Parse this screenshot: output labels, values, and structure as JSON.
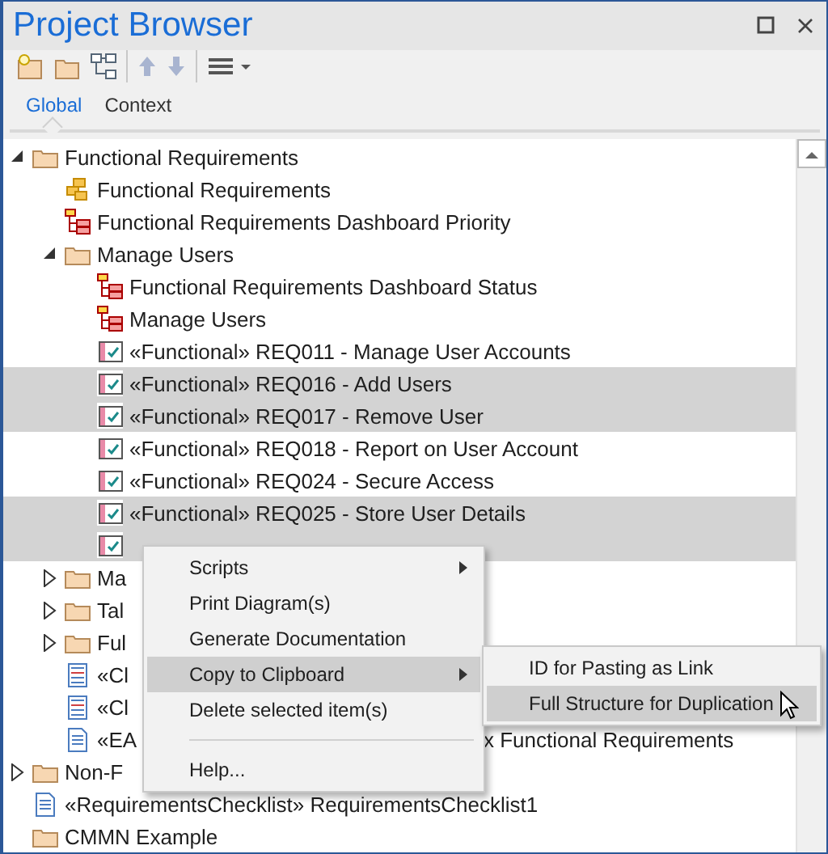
{
  "window": {
    "title": "Project Browser"
  },
  "tabs": [
    {
      "label": "Global",
      "selected": true
    },
    {
      "label": "Context",
      "selected": false
    }
  ],
  "tree": [
    {
      "children": [
        {
          "label": "Functional Requirements",
          "kind": "folder",
          "expanded": true,
          "selected": false,
          "children": [
            {
              "label": "Functional Requirements",
              "kind": "package",
              "selected": false
            },
            {
              "label": "Functional Requirements Dashboard Priority",
              "kind": "diagram",
              "selected": false
            },
            {
              "label": "Manage Users",
              "kind": "folder",
              "expanded": true,
              "selected": false,
              "children": [
                {
                  "label": "Functional Requirements Dashboard Status",
                  "kind": "diagram",
                  "selected": false
                },
                {
                  "label": "Manage Users",
                  "kind": "diagram",
                  "selected": false
                },
                {
                  "label": "«Functional» REQ011 - Manage User Accounts",
                  "kind": "requirement",
                  "selected": false
                },
                {
                  "label": "«Functional» REQ016 - Add Users",
                  "kind": "requirement",
                  "selected": true
                },
                {
                  "label": "«Functional» REQ017 - Remove User",
                  "kind": "requirement",
                  "selected": true
                },
                {
                  "label": "«Functional» REQ018 - Report on User Account",
                  "kind": "requirement",
                  "selected": false
                },
                {
                  "label": "«Functional» REQ024 - Secure Access",
                  "kind": "requirement",
                  "selected": false
                },
                {
                  "label": "«Functional» REQ025 - Store User Details",
                  "kind": "requirement",
                  "selected": true
                },
                {
                  "kind": "requirement",
                  "selected": true
                }
              ]
            },
            {
              "label": "Ma",
              "kind": "folder",
              "expanded": false,
              "selected": false
            },
            {
              "label": "Tal",
              "kind": "folder",
              "expanded": false,
              "selected": false
            },
            {
              "label": "Ful",
              "kind": "folder",
              "expanded": false,
              "selected": false
            },
            {
              "label": "«Cl",
              "kind": "checklist",
              "selected": false
            },
            {
              "label": "«Cl",
              "kind": "checklist",
              "selected": false
            },
            {
              "label": "«EA",
              "tail": "x Functional Requirements",
              "kind": "document",
              "selected": false
            }
          ]
        },
        {
          "label": "Non-F",
          "kind": "folder",
          "expanded": false,
          "selected": false
        },
        {
          "label": "«RequirementsChecklist» RequirementsChecklist1",
          "kind": "document",
          "selected": false
        }
      ]
    },
    {
      "label": "CMMN Example",
      "kind": "folder",
      "selected": false
    }
  ],
  "context_menu": {
    "items": [
      {
        "label": "Scripts",
        "submenu": true,
        "selected": false
      },
      {
        "label": "Print Diagram(s)",
        "submenu": false,
        "selected": false
      },
      {
        "label": "Generate Documentation",
        "submenu": false,
        "selected": false
      },
      {
        "label": "Copy to Clipboard",
        "submenu": true,
        "selected": true
      },
      {
        "label": "Delete selected item(s)",
        "submenu": false,
        "selected": false
      },
      {
        "kind": "separator"
      },
      {
        "label": "Help...",
        "submenu": false,
        "selected": false
      }
    ]
  },
  "submenu": {
    "items": [
      {
        "label": "ID for Pasting as Link",
        "selected": false
      },
      {
        "label": "Full Structure for Duplication",
        "selected": true
      }
    ]
  }
}
